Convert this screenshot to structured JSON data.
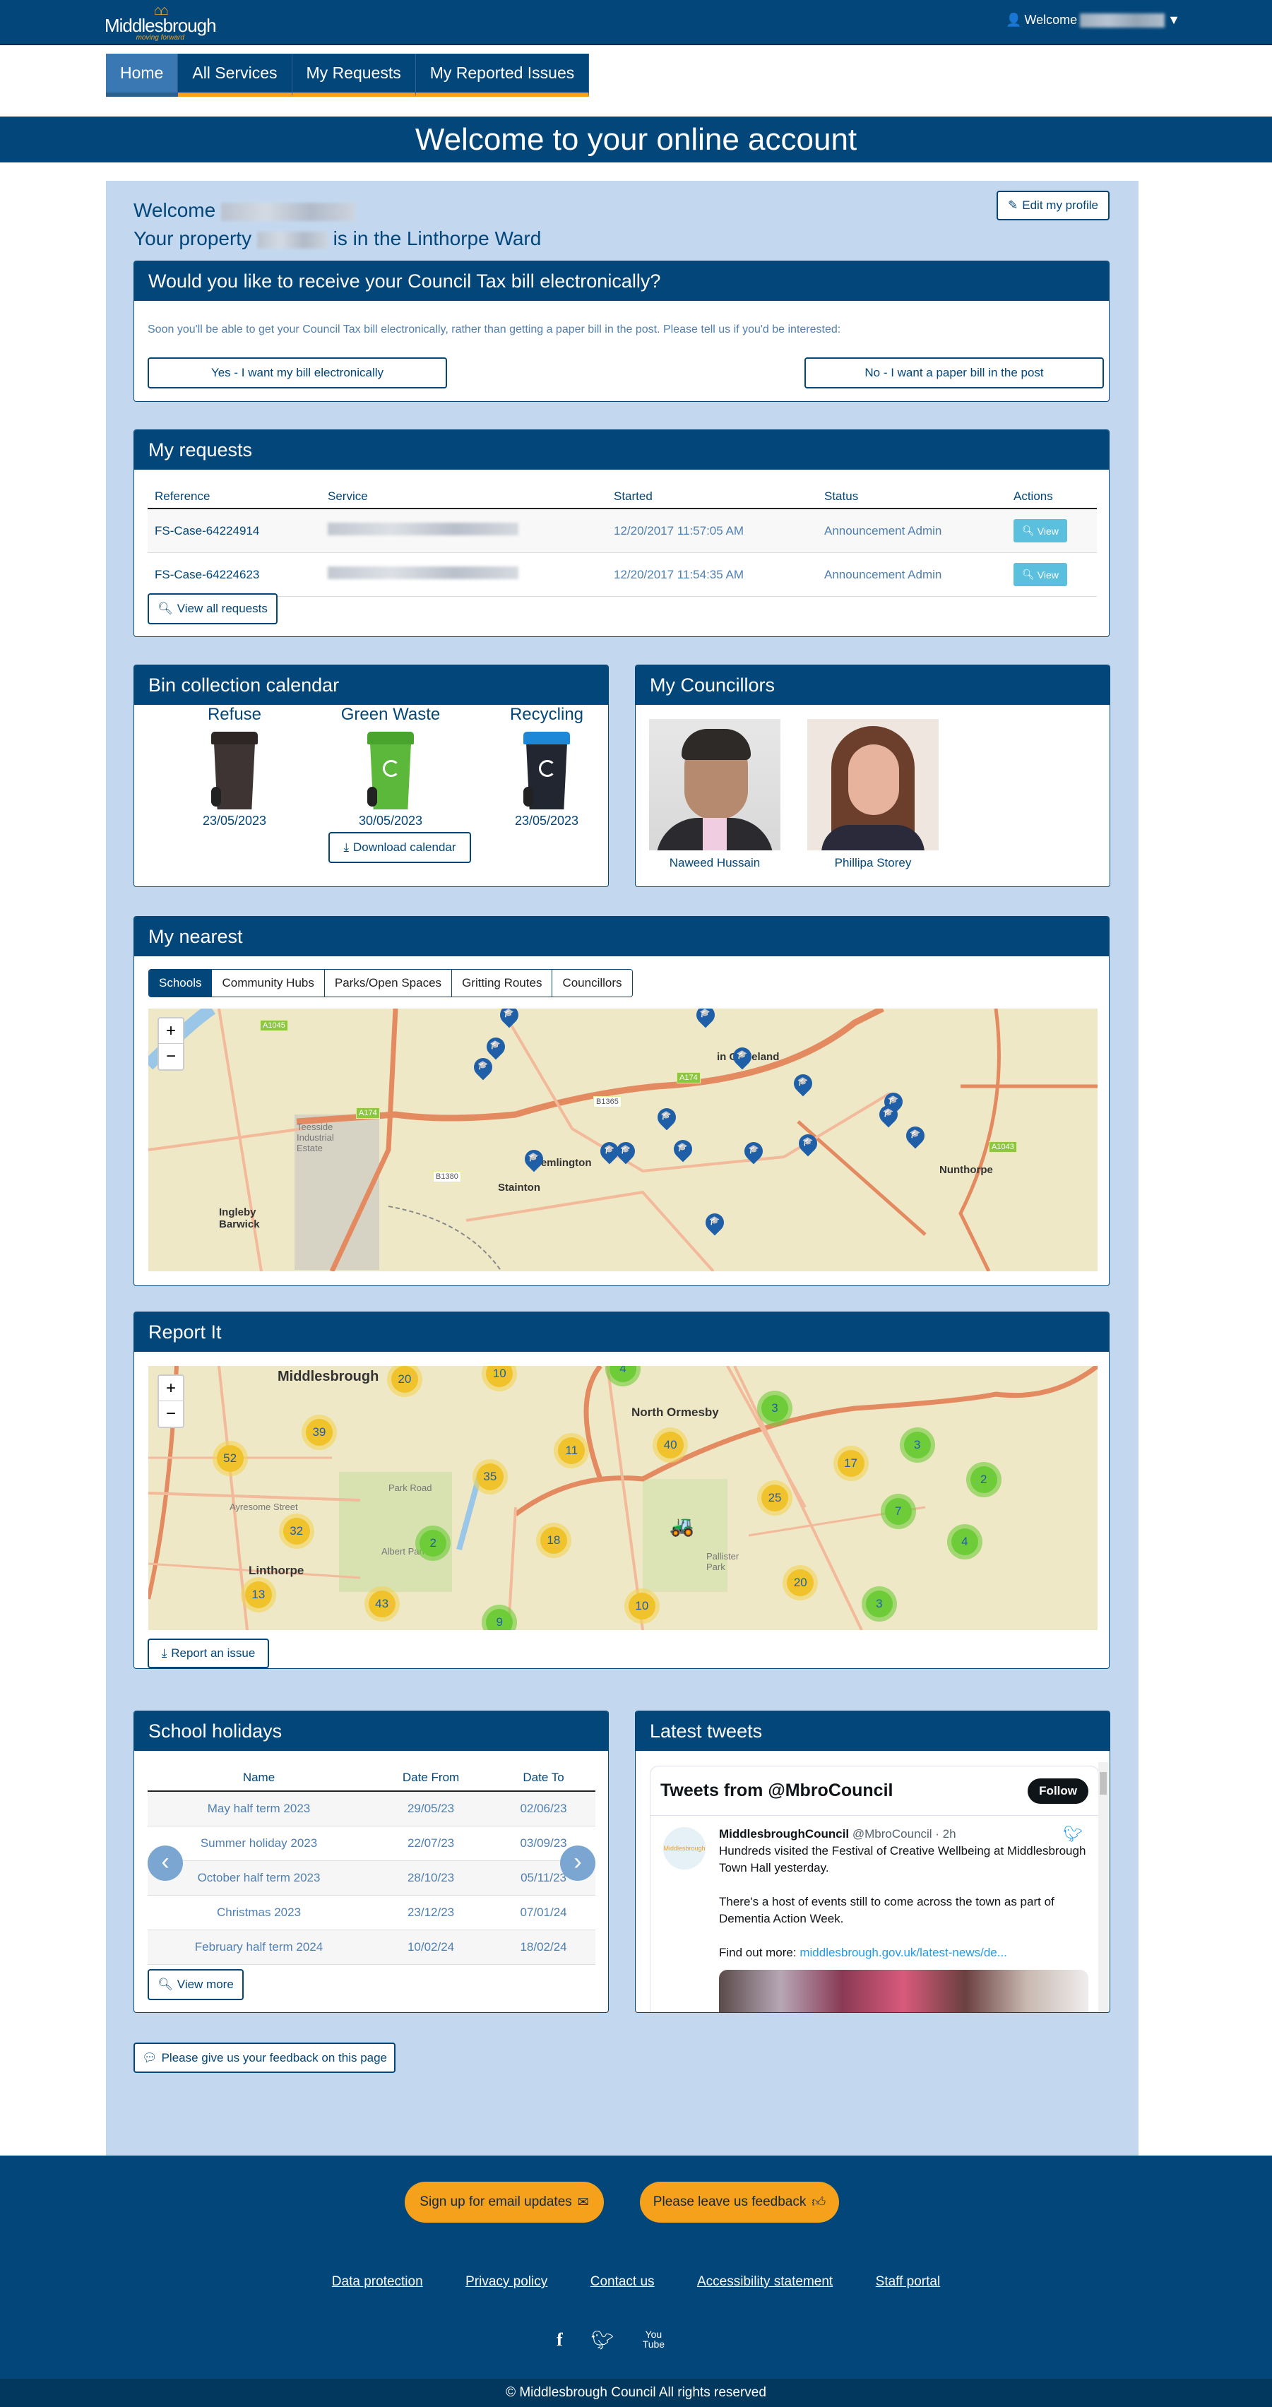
{
  "header": {
    "logo_text": "Middlesbrough",
    "logo_tagline": "moving forward",
    "welcome_label": "Welcome",
    "user_icon": "user-icon",
    "dropdown_icon": "caret-down-icon"
  },
  "nav": {
    "items": [
      {
        "label": "Home",
        "active": true
      },
      {
        "label": "All Services"
      },
      {
        "label": "My Requests"
      },
      {
        "label": "My Reported Issues"
      }
    ]
  },
  "banner": {
    "title": "Welcome to your online account"
  },
  "welcome": {
    "greeting": "Welcome",
    "property_prefix": "Your property",
    "property_suffix": "is in the Linthorpe Ward",
    "edit_profile": "Edit my profile"
  },
  "council_tax": {
    "title": "Would you like to receive your Council Tax bill electronically?",
    "text": "Soon you'll be able to get your Council Tax bill electronically, rather than getting a paper bill in the post. Please tell us if you'd be interested:",
    "yes": "Yes - I want my bill electronically",
    "no": "No - I want a paper bill in the post"
  },
  "requests": {
    "title": "My requests",
    "columns": [
      "Reference",
      "Service",
      "Started",
      "Status",
      "Actions"
    ],
    "rows": [
      {
        "reference": "FS-Case-64224914",
        "started": "12/20/2017 11:57:05 AM",
        "status": "Announcement Admin",
        "action": "View"
      },
      {
        "reference": "FS-Case-64224623",
        "started": "12/20/2017 11:54:35 AM",
        "status": "Announcement Admin",
        "action": "View"
      }
    ],
    "view_all": "View all requests"
  },
  "bins": {
    "title": "Bin collection calendar",
    "items": [
      {
        "label": "Refuse",
        "date": "23/05/2023",
        "color": "#3d3433",
        "lid": "#2d2625"
      },
      {
        "label": "Green Waste",
        "date": "30/05/2023",
        "color": "#5cb83a",
        "lid": "#48a42c"
      },
      {
        "label": "Recycling",
        "date": "23/05/2023",
        "color": "#222631",
        "lid": "#1e88d8"
      }
    ],
    "download": "Download calendar"
  },
  "councillors": {
    "title": "My Councillors",
    "people": [
      {
        "name": "Naweed Hussain"
      },
      {
        "name": "Phillipa Storey"
      }
    ]
  },
  "nearest": {
    "title": "My nearest",
    "tabs": [
      "Schools",
      "Community Hubs",
      "Parks/Open Spaces",
      "Gritting Routes",
      "Councillors"
    ],
    "active_tab": "Schools",
    "zoom_in": "+",
    "zoom_out": "−",
    "labels": [
      "Teesside Industrial Estate",
      "Hemlington",
      "Stainton",
      "Nunthorpe",
      "Ingleby Barwick",
      "in Cleveland"
    ],
    "road_signs": [
      "A1045",
      "A174",
      "A174",
      "B1365",
      "B1380",
      "A1043"
    ]
  },
  "report": {
    "title": "Report It",
    "zoom_in": "+",
    "zoom_out": "−",
    "labels": [
      "Middlesbrough",
      "North Ormesby",
      "Linthorpe",
      "Albert Park",
      "Park Road",
      "Ayresome Street",
      "Pallister Park"
    ],
    "clusters": [
      {
        "n": "20",
        "c": "y"
      },
      {
        "n": "10",
        "c": "y"
      },
      {
        "n": "4",
        "c": "g"
      },
      {
        "n": "39",
        "c": "y"
      },
      {
        "n": "52",
        "c": "y"
      },
      {
        "n": "11",
        "c": "y"
      },
      {
        "n": "40",
        "c": "y"
      },
      {
        "n": "3",
        "c": "g"
      },
      {
        "n": "35",
        "c": "y"
      },
      {
        "n": "3",
        "c": "g"
      },
      {
        "n": "17",
        "c": "y"
      },
      {
        "n": "2",
        "c": "g"
      },
      {
        "n": "25",
        "c": "y"
      },
      {
        "n": "7",
        "c": "g"
      },
      {
        "n": "32",
        "c": "y"
      },
      {
        "n": "2",
        "c": "g"
      },
      {
        "n": "18",
        "c": "y"
      },
      {
        "n": "4",
        "c": "g"
      },
      {
        "n": "13",
        "c": "y"
      },
      {
        "n": "43",
        "c": "y"
      },
      {
        "n": "20",
        "c": "y"
      },
      {
        "n": "10",
        "c": "y"
      },
      {
        "n": "3",
        "c": "g"
      },
      {
        "n": "9",
        "c": "g"
      }
    ],
    "report_button": "Report an issue"
  },
  "holidays": {
    "title": "School holidays",
    "columns": [
      "Name",
      "Date From",
      "Date To"
    ],
    "rows": [
      [
        "May half term 2023",
        "29/05/23",
        "02/06/23"
      ],
      [
        "Summer holiday 2023",
        "22/07/23",
        "03/09/23"
      ],
      [
        "October half term 2023",
        "28/10/23",
        "05/11/23"
      ],
      [
        "Christmas 2023",
        "23/12/23",
        "07/01/24"
      ],
      [
        "February half term 2024",
        "10/02/24",
        "18/02/24"
      ]
    ],
    "view_more": "View more"
  },
  "tweets": {
    "title": "Latest tweets",
    "header": "Tweets from @MbroCouncil",
    "follow": "Follow",
    "author": "MiddlesbroughCouncil",
    "handle": "@MbroCouncil · 2h",
    "p1": "Hundreds visited the Festival of Creative Wellbeing at Middlesbrough Town Hall yesterday.",
    "p2": "There's a host of events still to come across the town as part of Dementia Action Week.",
    "p3_prefix": "Find out more:",
    "p3_link": "middlesbrough.gov.uk/latest-news/de...",
    "avatar_text": "Middlesbrough"
  },
  "feedback_page": "Please give us your feedback on this page",
  "footer": {
    "email_updates": "Sign up for email updates",
    "leave_feedback": "Please leave us feedback",
    "links": [
      "Data protection",
      "Privacy policy",
      "Contact us",
      "Accessibility statement",
      "Staff portal"
    ],
    "social": [
      "facebook-icon",
      "twitter-icon",
      "youtube-icon"
    ],
    "copyright": "© Middlesbrough Council All rights reserved"
  },
  "colors": {
    "brand": "#034679",
    "accent": "#f5a11c",
    "background": "#c3d8ef",
    "view_button": "#5bc0de"
  }
}
